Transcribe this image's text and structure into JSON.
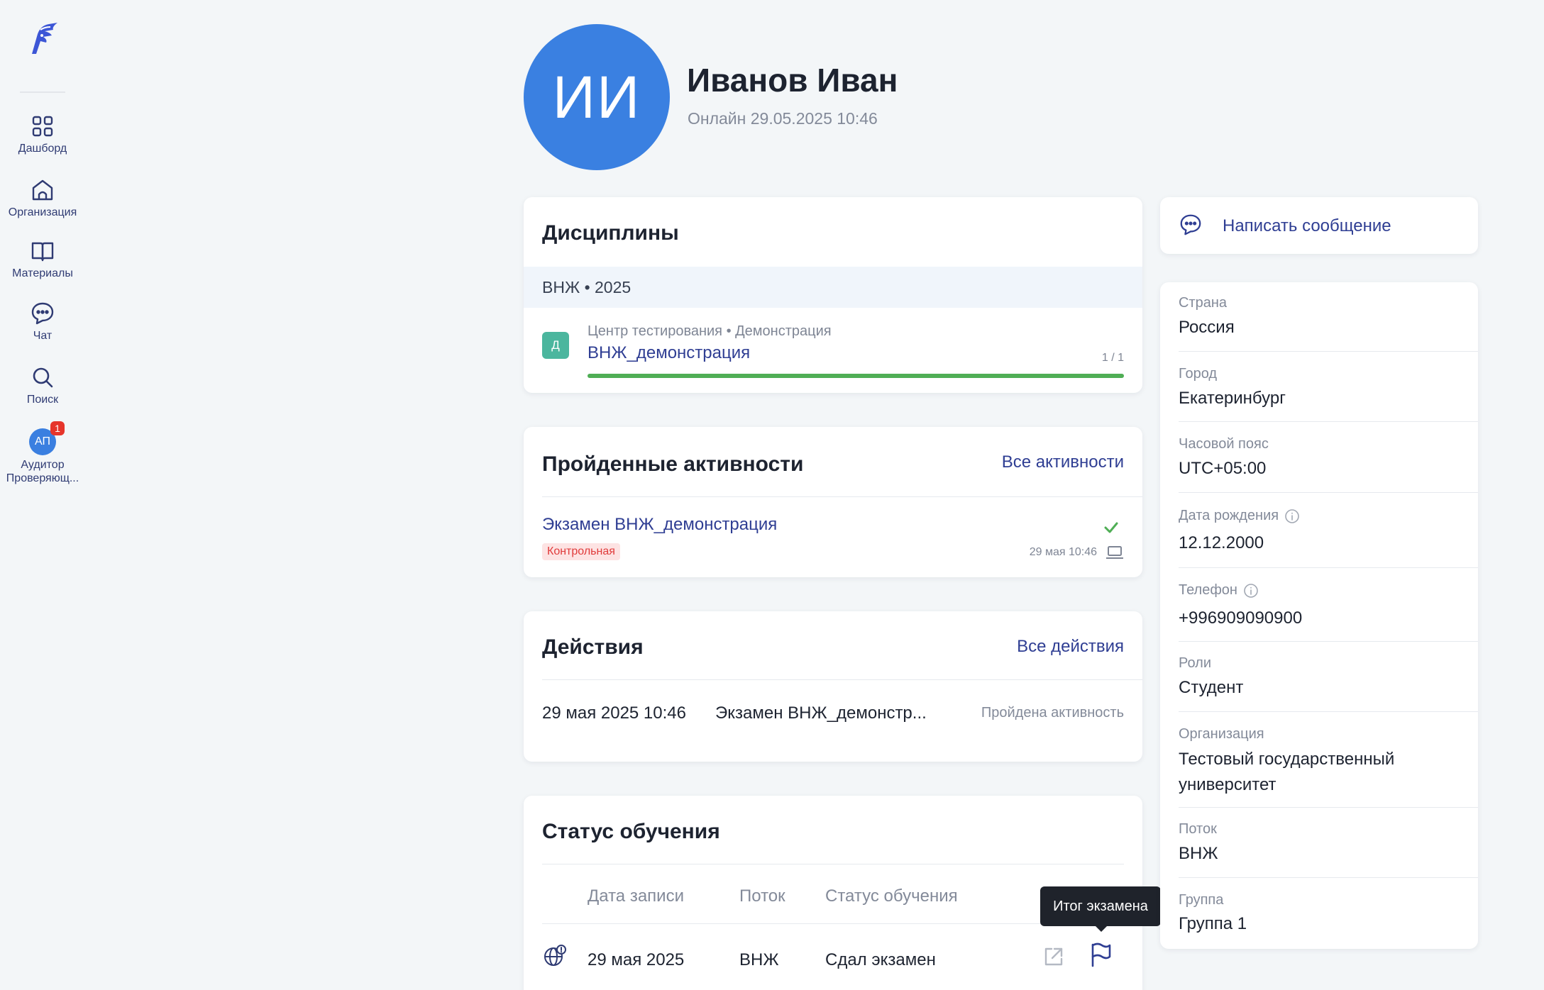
{
  "sidebar": {
    "items": [
      {
        "label": "Дашборд",
        "icon": "grid-icon"
      },
      {
        "label": "Организация",
        "icon": "organization-icon"
      },
      {
        "label": "Материалы",
        "icon": "book-icon"
      },
      {
        "label": "Чат",
        "icon": "chat-icon"
      },
      {
        "label": "Поиск",
        "icon": "search-icon"
      }
    ],
    "user": {
      "initials": "АП",
      "badge": "1",
      "label": "Аудитор Проверяющ..."
    }
  },
  "profile": {
    "initials": "ИИ",
    "name": "Иванов Иван",
    "online": "Онлайн 29.05.2025 10:46"
  },
  "disciplines": {
    "title": "Дисциплины",
    "group": "ВНЖ • 2025",
    "item": {
      "badge": "Д",
      "subtitle": "Центр тестирования • Демонстрация",
      "name": "ВНЖ_демонстрация",
      "count": "1 / 1",
      "progress": 1.0
    }
  },
  "activities": {
    "title": "Пройденные активности",
    "all_link": "Все активности",
    "item": {
      "name": "Экзамен ВНЖ_демонстрация",
      "tag": "Контрольная",
      "date": "29 мая 10:46"
    }
  },
  "actions": {
    "title": "Действия",
    "all_link": "Все действия",
    "row": {
      "date": "29 мая 2025 10:46",
      "name": "Экзамен ВНЖ_демонстр...",
      "status": "Пройдена активность"
    }
  },
  "status": {
    "title": "Статус обучения",
    "headers": [
      "Дата записи",
      "Поток",
      "Статус обучения"
    ],
    "row": {
      "date": "29 мая 2025",
      "stream": "ВНЖ",
      "status": "Сдал экзамен"
    },
    "tooltip": "Итог экзамена"
  },
  "message": {
    "label": "Написать сообщение"
  },
  "info": {
    "country": {
      "label": "Страна",
      "value": "Россия"
    },
    "city": {
      "label": "Город",
      "value": "Екатеринбург"
    },
    "timezone": {
      "label": "Часовой пояс",
      "value": "UTC+05:00"
    },
    "birthday": {
      "label": "Дата рождения",
      "value": "12.12.2000"
    },
    "phone": {
      "label": "Телефон",
      "value": "+996909090900"
    },
    "roles": {
      "label": "Роли",
      "value": "Студент"
    },
    "organization": {
      "label": "Организация",
      "value": "Тестовый государственный университет"
    },
    "stream": {
      "label": "Поток",
      "value": "ВНЖ"
    },
    "group": {
      "label": "Группа",
      "value": "Группа 1"
    }
  },
  "colors": {
    "accent": "#2f3e93",
    "avatar": "#3a80e1",
    "success": "#4fae55",
    "discipline_badge": "#4bb69e",
    "tag_bg": "#fde3e3",
    "tag_text": "#e03b3b"
  }
}
